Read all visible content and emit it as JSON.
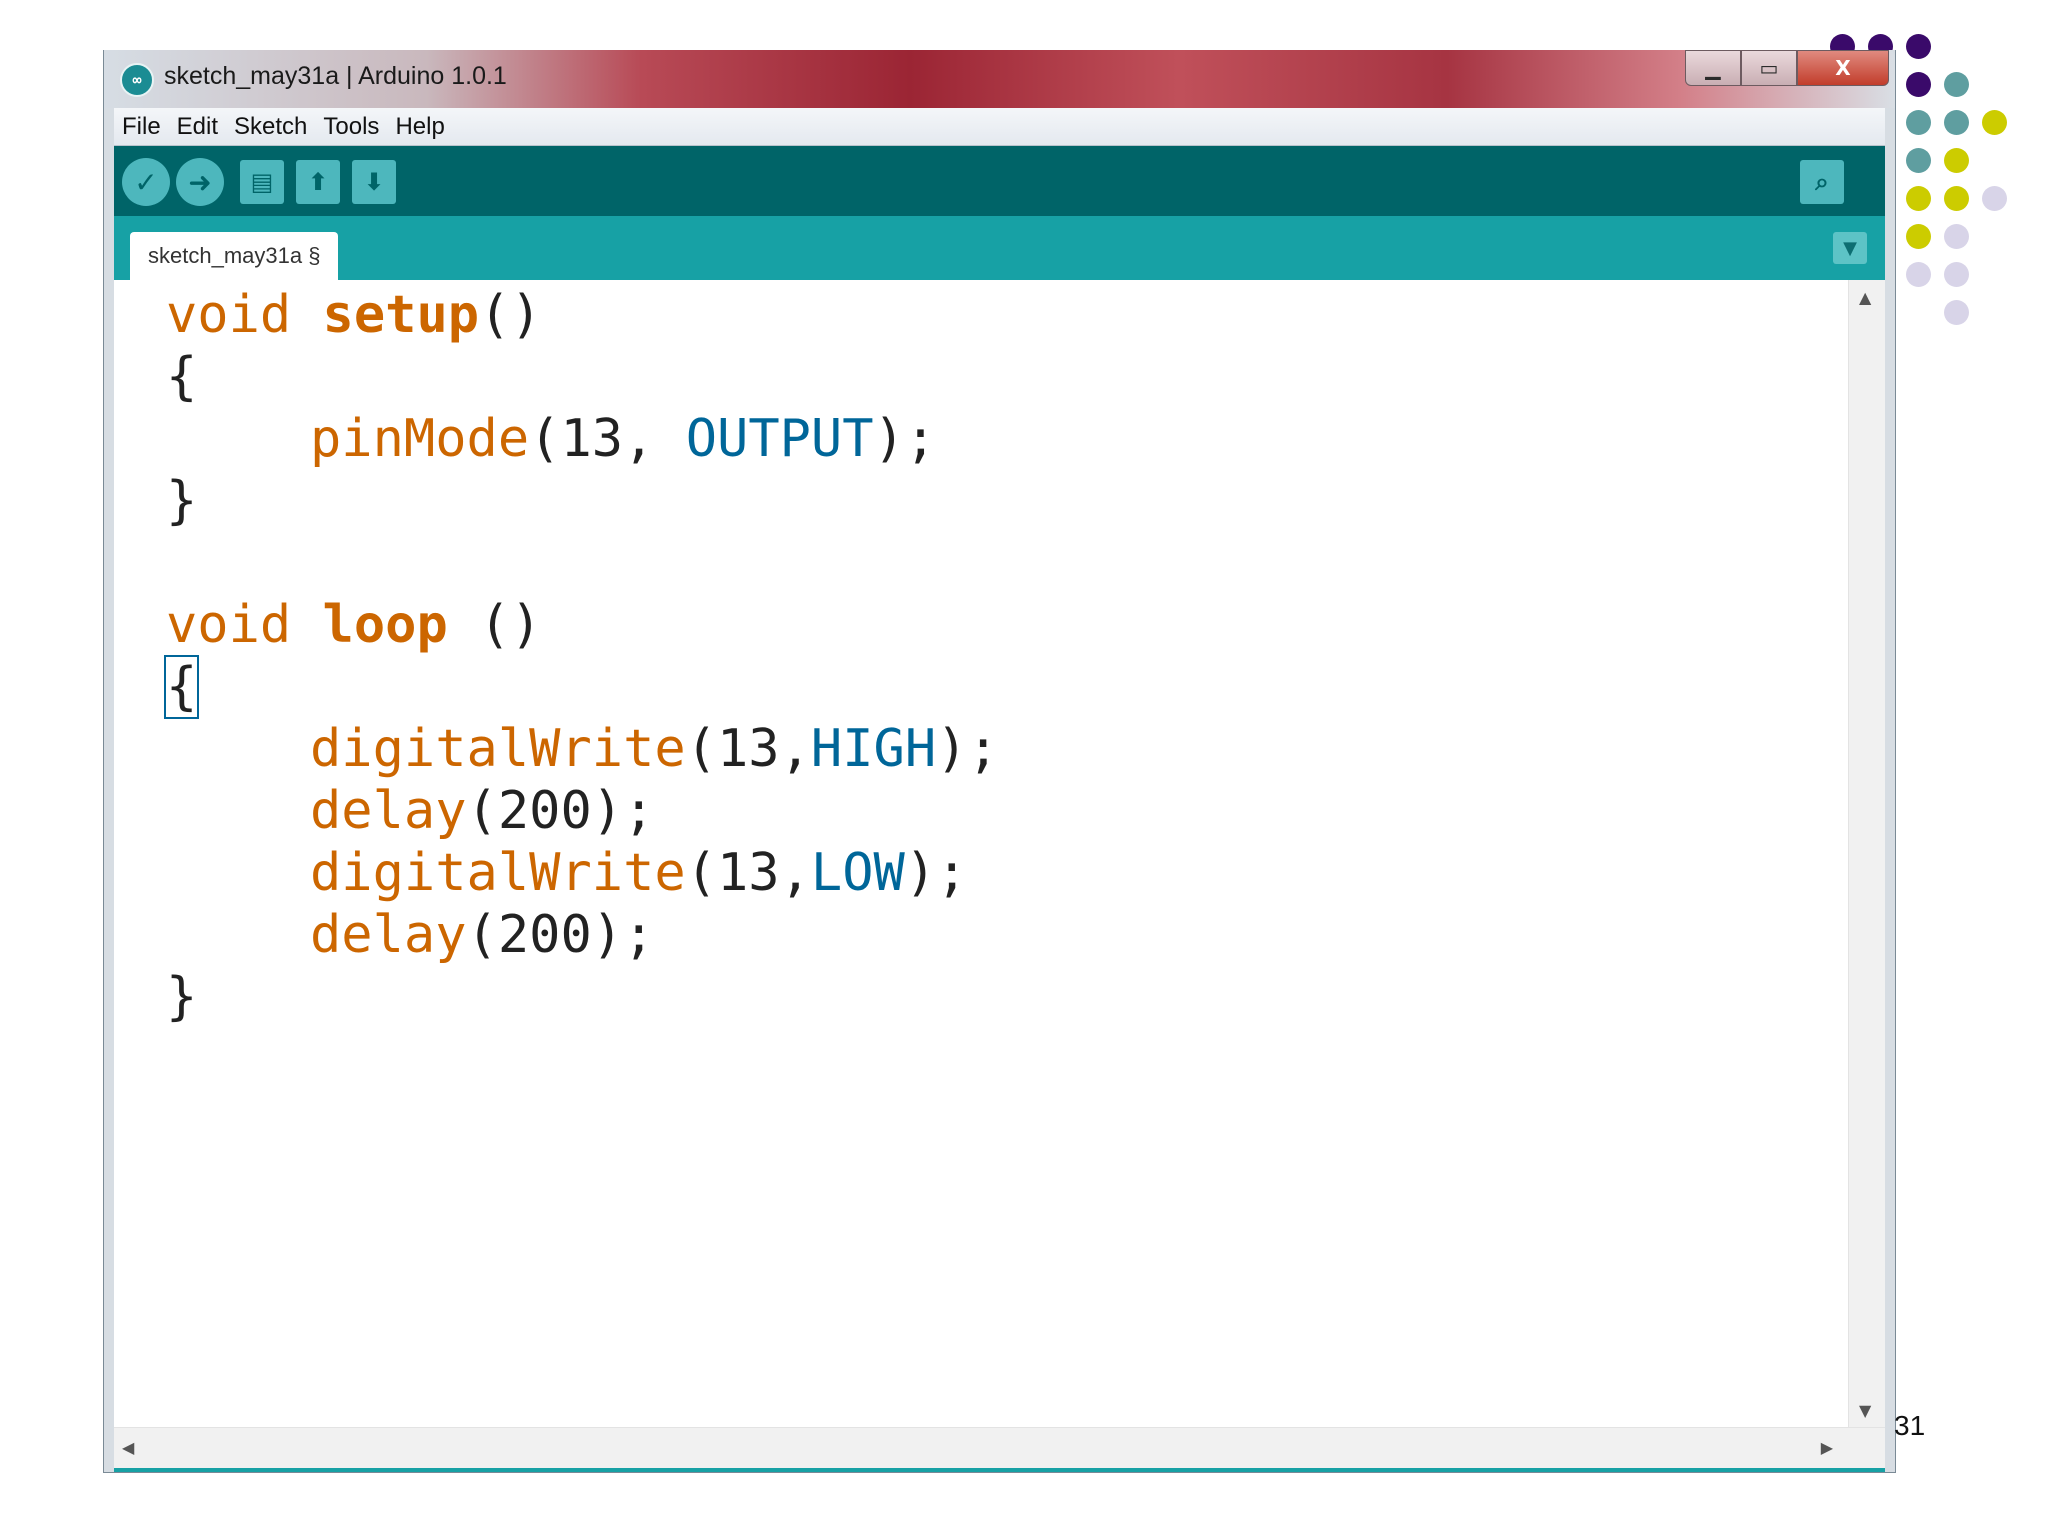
{
  "window": {
    "title": "sketch_may31a | Arduino 1.0.1",
    "controls": {
      "minimize": "▁",
      "maximize": "▭",
      "close": "X"
    }
  },
  "menu": [
    "File",
    "Edit",
    "Sketch",
    "Tools",
    "Help"
  ],
  "toolbar": {
    "buttons": [
      {
        "name": "verify",
        "icon": "checkmark-icon",
        "glyph": "✓"
      },
      {
        "name": "upload",
        "icon": "arrow-right-icon",
        "glyph": "➜"
      },
      {
        "name": "new",
        "icon": "new-file-icon",
        "glyph": "▤"
      },
      {
        "name": "open",
        "icon": "arrow-up-icon",
        "glyph": "⬆"
      },
      {
        "name": "save",
        "icon": "arrow-down-icon",
        "glyph": "⬇"
      }
    ],
    "serial_monitor": {
      "icon": "magnifier-icon",
      "glyph": "⌕"
    }
  },
  "tab": {
    "label": "sketch_may31a §",
    "menu_glyph": "▼"
  },
  "code": {
    "l1": {
      "type": "void",
      "name": "setup",
      "rest": "()"
    },
    "l2": "{",
    "l3": {
      "fn": "pinMode",
      "open": "(13, ",
      "const": "OUTPUT",
      "close": ");"
    },
    "l4": "}",
    "l6": {
      "type": "void",
      "name": "loop",
      "rest": " ()"
    },
    "l7": "{",
    "l8": {
      "fn": "digitalWrite",
      "open": "(13,",
      "const": "HIGH",
      "close": ");"
    },
    "l9": {
      "fn": "delay",
      "rest": "(200);"
    },
    "l10": {
      "fn": "digitalWrite",
      "open": "(13,",
      "const": "LOW",
      "close": ");"
    },
    "l11": {
      "fn": "delay",
      "rest": "(200);"
    },
    "l12": "}"
  },
  "scroll": {
    "up": "▲",
    "down": "▼",
    "left": "◀",
    "right": "▶"
  },
  "slide_number": "31",
  "colors": {
    "teal_dark": "#006468",
    "teal_tab": "#17a1a5",
    "keyword_orange": "#cc6600",
    "constant_blue": "#006699",
    "dot_purple": "#3a0a6a",
    "dot_teal": "#5f9ea0",
    "dot_yellow": "#cccc00",
    "dot_lavender": "#d8d4e8"
  }
}
